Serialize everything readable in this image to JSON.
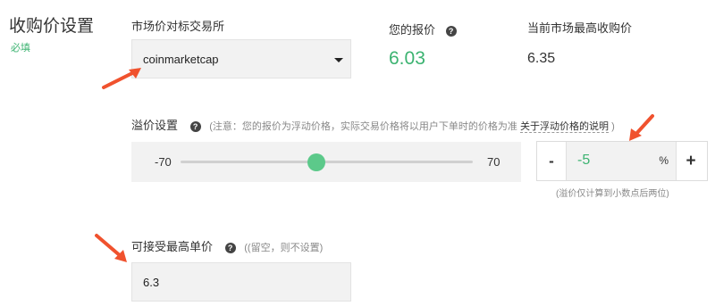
{
  "section": {
    "title": "收购价设置",
    "required_label": "必填"
  },
  "exchange": {
    "label": "市场价对标交易所",
    "selected": "coinmarketcap"
  },
  "your_price": {
    "label": "您的报价",
    "value": "6.03"
  },
  "market_max": {
    "label": "当前市场最高收购价",
    "value": "6.35"
  },
  "premium": {
    "label": "溢价设置",
    "note_prefix": "(注意：您的报价为浮动价格，实际交易价格将以用户下单时的价格为准",
    "note_link": "关于浮动价格的说明",
    "note_suffix": ")",
    "slider_min": "-70",
    "slider_max": "70",
    "slider_value": -5,
    "minus_label": "-",
    "plus_label": "+",
    "value": "-5",
    "unit": "%",
    "hint": "(溢价仅计算到小数点后两位)"
  },
  "max_unit_price": {
    "label": "可接受最高单价",
    "note": "((留空，则不设置)",
    "value": "6.3"
  },
  "icons": {
    "help": "question-circle-icon",
    "caret": "caret-down-icon",
    "annotation": "red-arrow-icon"
  },
  "colors": {
    "accent_green": "#3cb371",
    "slider_thumb": "#5cc98a",
    "annotation_red": "#f0522e"
  }
}
